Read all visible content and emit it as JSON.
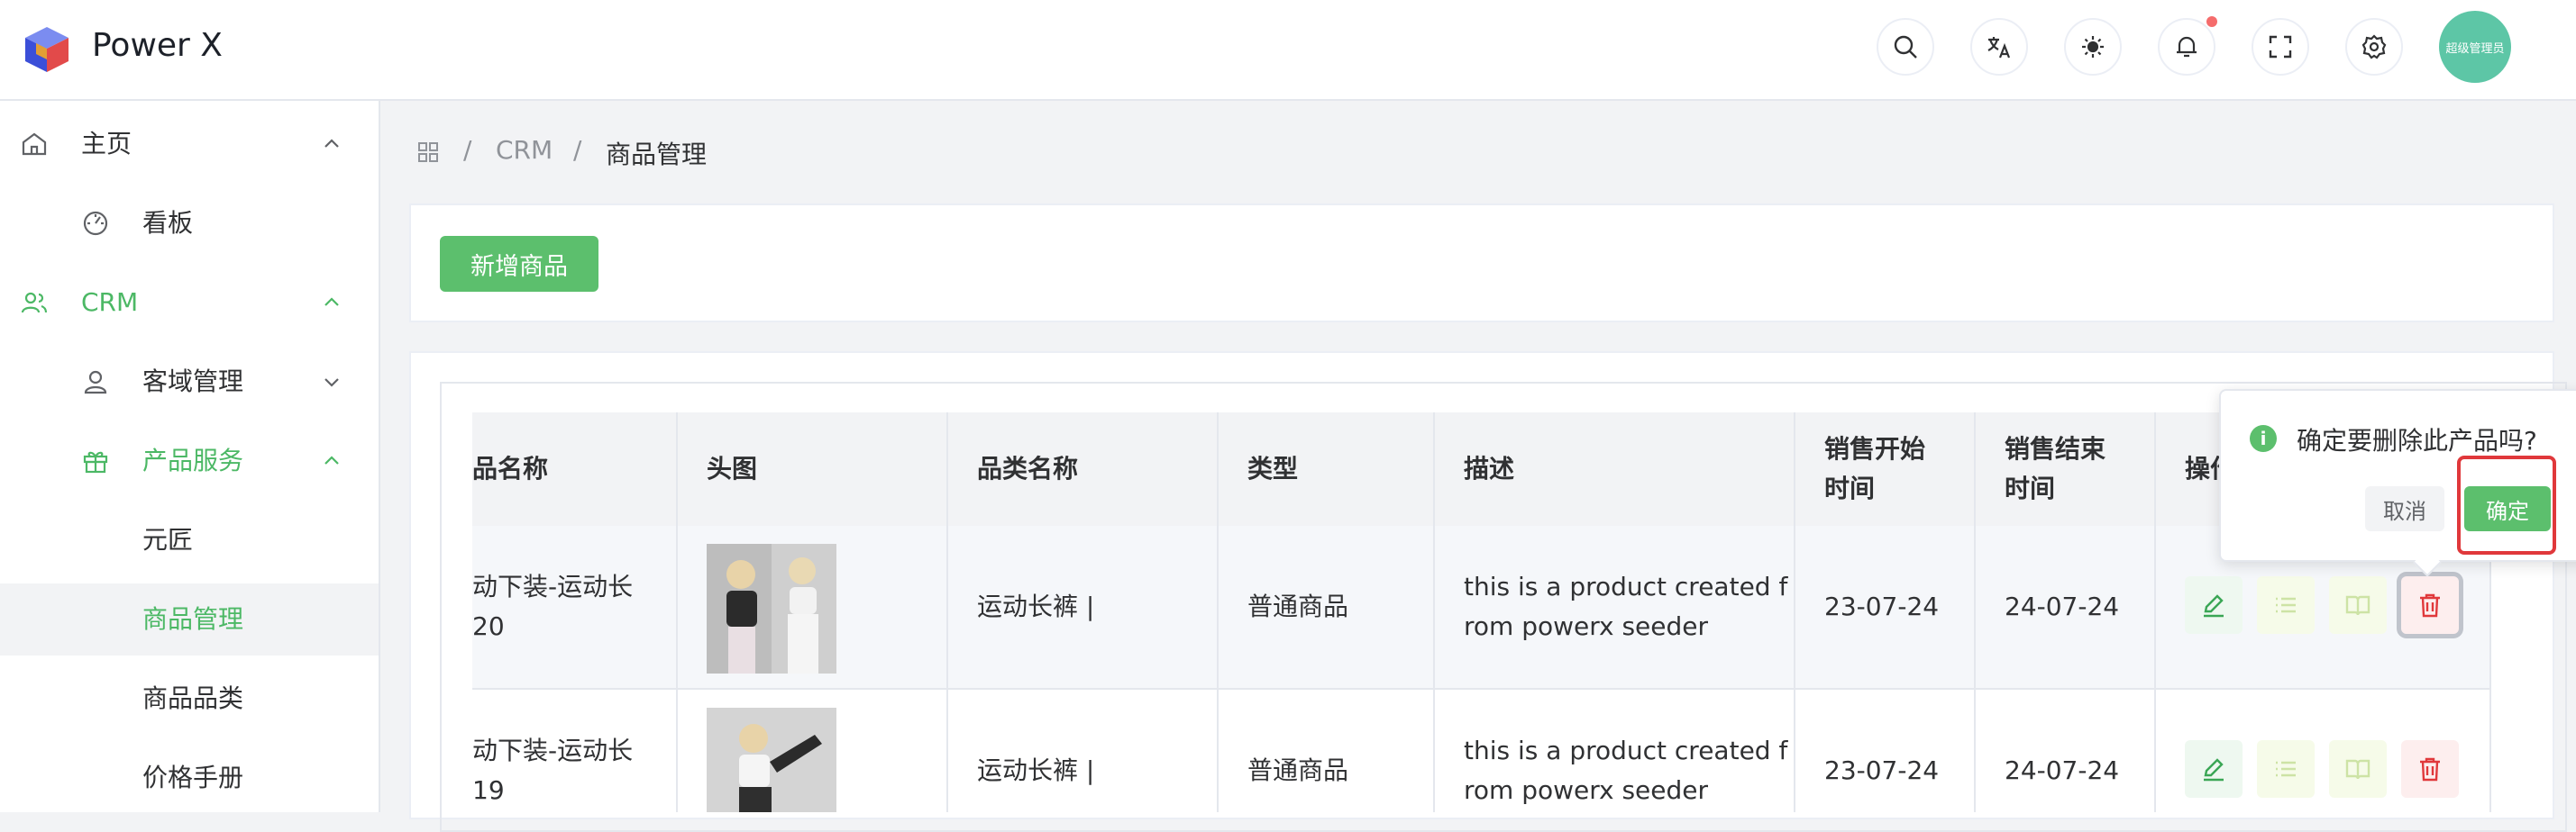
{
  "app": {
    "title": "Power X"
  },
  "header": {
    "icons": [
      "search-icon",
      "translate-icon",
      "theme-icon",
      "bell-icon",
      "fullscreen-icon",
      "gear-icon"
    ],
    "avatar_text": "超级管理员"
  },
  "sidebar": {
    "items": [
      {
        "label": "主页",
        "icon": "home-icon",
        "expanded": true
      },
      {
        "label": "看板",
        "icon": "dashboard-icon"
      },
      {
        "label": "CRM",
        "icon": "users-icon",
        "expanded": true
      },
      {
        "label": "客域管理",
        "icon": "user-icon",
        "expanded": false
      },
      {
        "label": "产品服务",
        "icon": "gift-icon",
        "expanded": true
      },
      {
        "label": "元匠"
      },
      {
        "label": "商品管理",
        "active": true
      },
      {
        "label": "商品品类"
      },
      {
        "label": "价格手册"
      }
    ],
    "accent_color": "#4cb865"
  },
  "breadcrumb": {
    "icon": "apps-icon",
    "items": [
      "CRM",
      "商品管理"
    ],
    "separator": "/"
  },
  "toolbar": {
    "add_label": "新增商品"
  },
  "table": {
    "columns": [
      "品名称",
      "头图",
      "品类名称",
      "类型",
      "描述",
      "销售开始时间",
      "销售结束时间",
      "操作"
    ],
    "column_lines": {
      "name": [
        "品名称"
      ],
      "start": [
        "销售开始",
        "时间"
      ],
      "end": [
        "销售结束",
        "时间"
      ],
      "ops": [
        "操作"
      ]
    },
    "rows": [
      {
        "name_lines": [
          "动下装-运动长",
          "20"
        ],
        "category": "运动长裤 |",
        "type": "普通商品",
        "desc_lines": [
          "this is a product created f",
          "rom powerx seeder"
        ],
        "start": "23-07-24",
        "end": "24-07-24"
      },
      {
        "name_lines": [
          "动下装-运动长",
          "19"
        ],
        "category": "运动长裤 |",
        "type": "普通商品",
        "desc_lines": [
          "this is a product created f",
          "rom powerx seeder"
        ],
        "start": "23-07-24",
        "end": "24-07-24"
      }
    ],
    "action_icons": [
      "edit-icon",
      "list-icon",
      "book-icon",
      "trash-icon"
    ]
  },
  "popconfirm": {
    "message": "确定要删除此产品吗?",
    "cancel_label": "取消",
    "confirm_label": "确定"
  },
  "colors": {
    "primary": "#5cbf6d",
    "danger": "#e0383b",
    "highlight": "#e0383b"
  }
}
